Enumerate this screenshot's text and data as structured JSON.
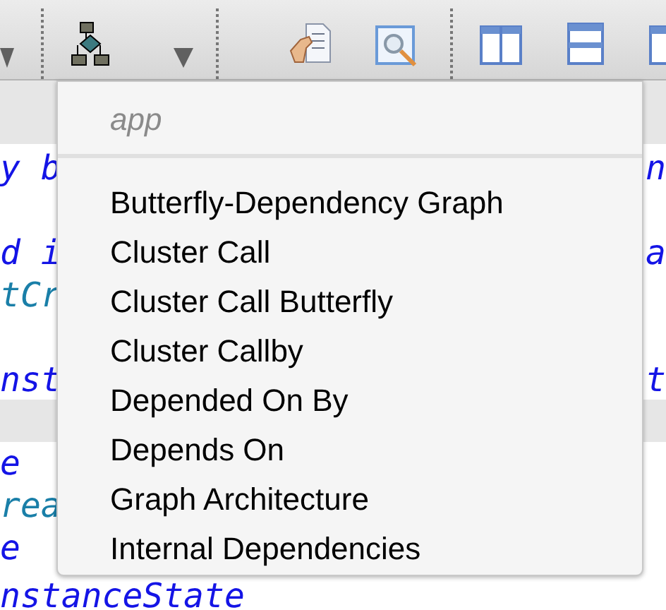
{
  "code_panels": [
    {
      "lines": [
        {
          "left": "y b",
          "right": "n",
          "color": "#1414e6"
        },
        {
          "left": "d i",
          "right": "a",
          "color": "#1414e6"
        },
        {
          "left": "tCr",
          "color": "#1a7fa8"
        },
        {
          "left": "nst",
          "right": "t",
          "color": "#1414e6"
        }
      ]
    },
    {
      "lines": [
        {
          "left": "e",
          "color": "#1414e6"
        },
        {
          "left": "rea",
          "color": "#1a7fa8"
        },
        {
          "left": "e",
          "color": "#1414e6"
        },
        {
          "left": "nstanceState",
          "color": "#1414e6"
        }
      ]
    }
  ],
  "menu": {
    "header": "app",
    "items": [
      "Butterfly-Dependency Graph",
      "Cluster Call",
      "Cluster Call Butterfly",
      "Cluster Callby",
      "Depended On By",
      "Depends On",
      "Graph Architecture",
      "Internal Dependencies"
    ]
  }
}
